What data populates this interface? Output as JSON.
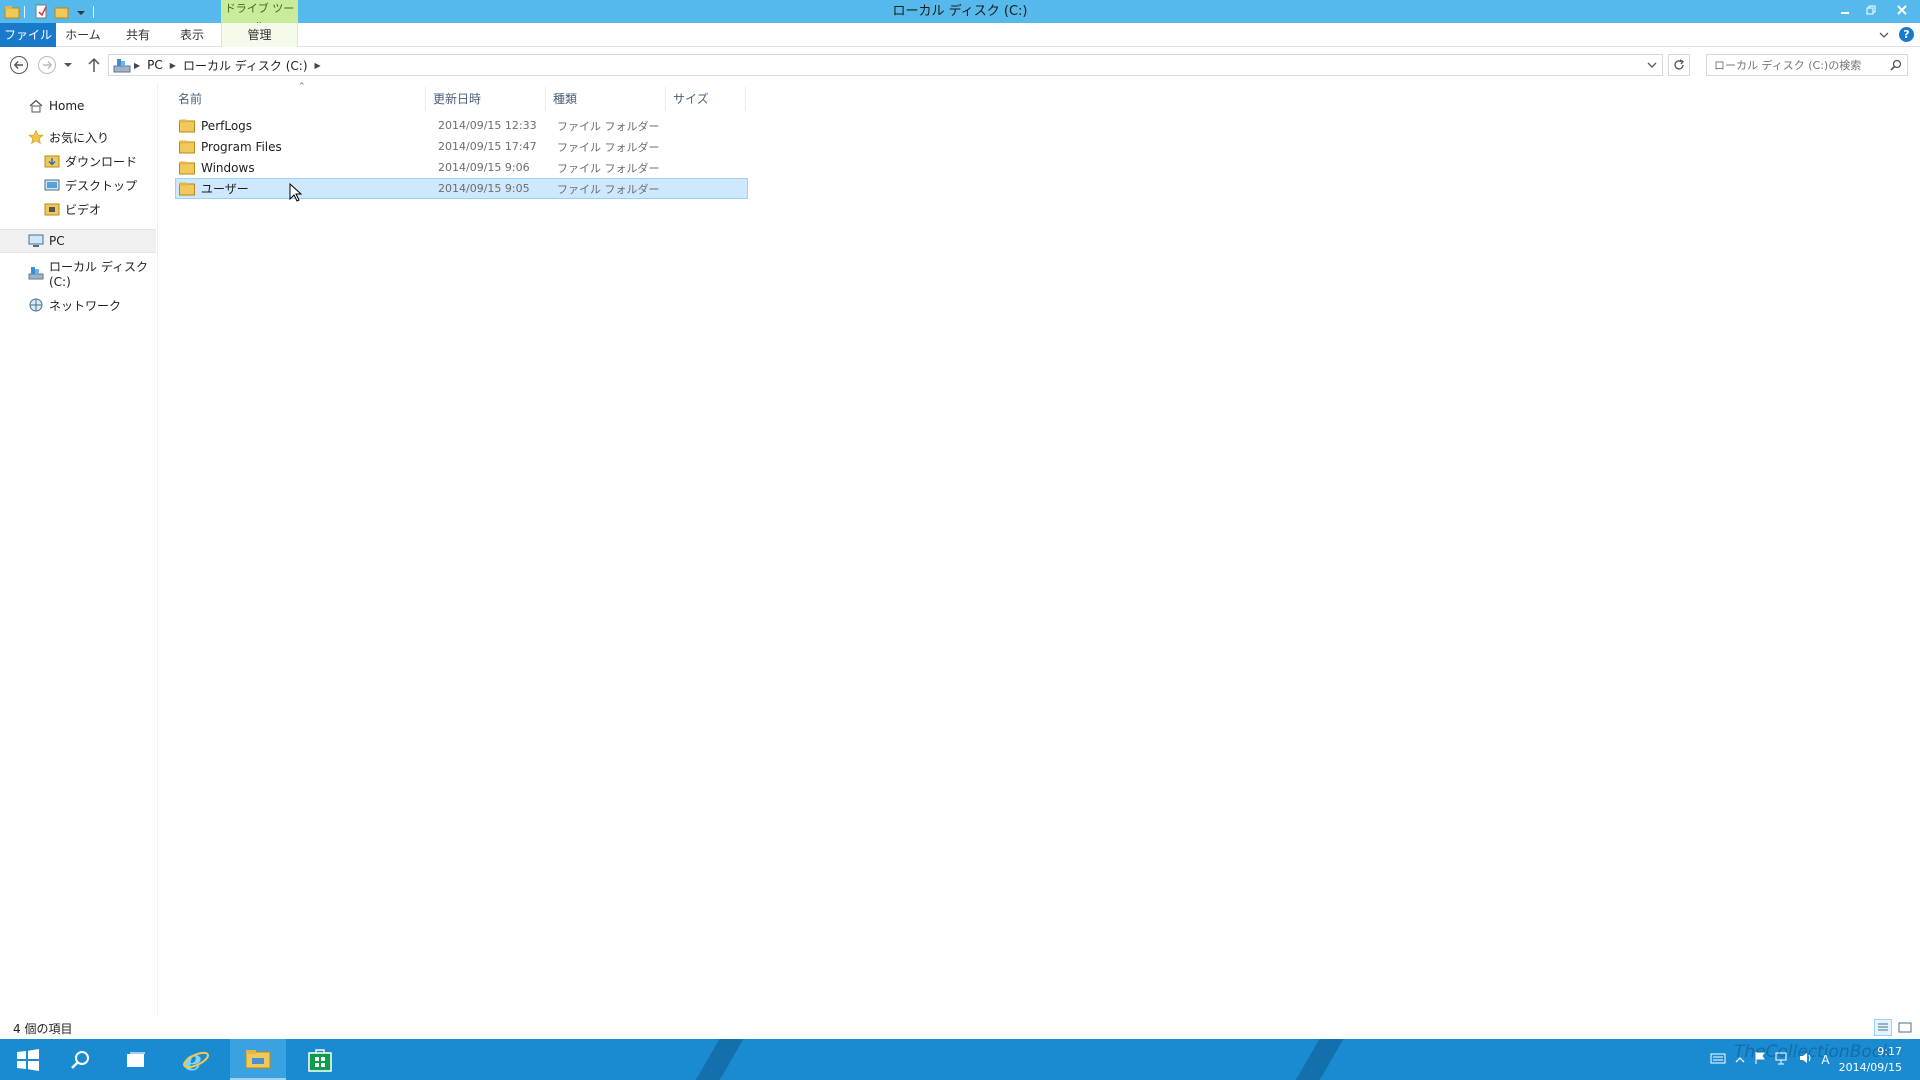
{
  "window": {
    "title": "ローカル ディスク (C:)",
    "context_tab_group": "ドライブ ツール"
  },
  "ribbon": {
    "tabs": [
      {
        "label": "ファイル"
      },
      {
        "label": "ホーム"
      },
      {
        "label": "共有"
      },
      {
        "label": "表示"
      },
      {
        "label": "管理"
      }
    ]
  },
  "address": {
    "crumbs": [
      "PC",
      "ローカル ディスク (C:)"
    ],
    "search_placeholder": "ローカル ディスク (C:)の検索"
  },
  "navpane": {
    "items": [
      {
        "label": "Home",
        "icon": "home-icon"
      },
      {
        "label": "お気に入り",
        "icon": "star-icon"
      },
      {
        "label": "ダウンロード",
        "icon": "download-folder-icon"
      },
      {
        "label": "デスクトップ",
        "icon": "desktop-icon"
      },
      {
        "label": "ビデオ",
        "icon": "video-folder-icon"
      },
      {
        "label": "PC",
        "icon": "pc-icon"
      },
      {
        "label": "ローカル ディスク (C:)",
        "icon": "drive-icon"
      },
      {
        "label": "ネットワーク",
        "icon": "network-icon"
      }
    ]
  },
  "columns": {
    "name": "名前",
    "date": "更新日時",
    "type": "種類",
    "size": "サイズ"
  },
  "files": [
    {
      "name": "PerfLogs",
      "date": "2014/09/15 12:33",
      "type": "ファイル フォルダー",
      "selected": false
    },
    {
      "name": "Program Files",
      "date": "2014/09/15 17:47",
      "type": "ファイル フォルダー",
      "selected": false
    },
    {
      "name": "Windows",
      "date": "2014/09/15 9:06",
      "type": "ファイル フォルダー",
      "selected": false
    },
    {
      "name": "ユーザー",
      "date": "2014/09/15 9:05",
      "type": "ファイル フォルダー",
      "selected": true
    }
  ],
  "status": {
    "item_count": "4 個の項目"
  },
  "taskbar": {
    "clock_time": "9:17",
    "clock_date": "2014/09/15",
    "ime": "A",
    "watermark": "TheCollectionBook"
  },
  "colors": {
    "titlebar": "#56b9ec",
    "file_tab": "#1979ca",
    "context_tab": "#c9ec9a",
    "selection": "#cde8ff",
    "taskbar": "#1a8bd0"
  }
}
